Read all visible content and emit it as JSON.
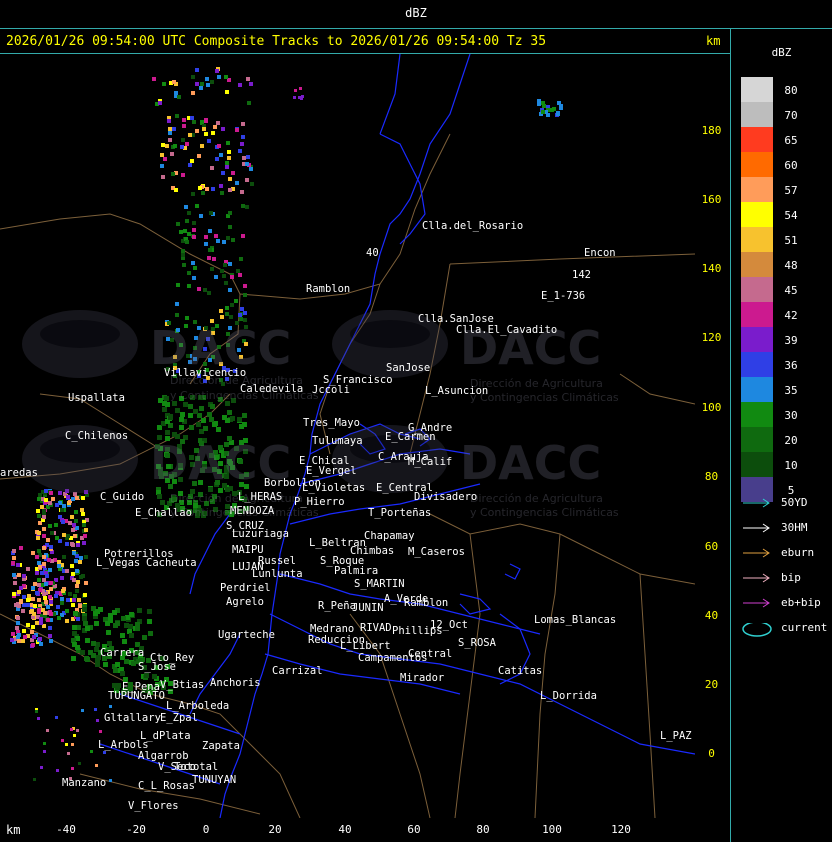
{
  "header": {
    "field": "dBZ",
    "title": "2026/01/26 09:54:00 UTC Composite Tracks to 2026/01/26 09:54:00 Tz 35",
    "units": "km"
  },
  "y_axis": {
    "ticks": [
      "180",
      "160",
      "140",
      "120",
      "100",
      "80",
      "60",
      "40",
      "20",
      "0"
    ]
  },
  "x_axis": {
    "unit": "km",
    "ticks": [
      "-40",
      "-20",
      "0",
      "20",
      "40",
      "60",
      "80",
      "100",
      "120"
    ]
  },
  "legend": {
    "title": "dBZ",
    "scale": [
      {
        "value": "80",
        "color": "#d6d6d6"
      },
      {
        "value": "70",
        "color": "#bdbdbd"
      },
      {
        "value": "65",
        "color": "#ff3b1f"
      },
      {
        "value": "60",
        "color": "#ff6a00"
      },
      {
        "value": "57",
        "color": "#ff9c5a"
      },
      {
        "value": "54",
        "color": "#ffff00"
      },
      {
        "value": "51",
        "color": "#f7c22e"
      },
      {
        "value": "48",
        "color": "#d48a3c"
      },
      {
        "value": "45",
        "color": "#c56a8e"
      },
      {
        "value": "42",
        "color": "#cc1a8f"
      },
      {
        "value": "39",
        "color": "#7a1ccc"
      },
      {
        "value": "36",
        "color": "#2f3fe6"
      },
      {
        "value": "35",
        "color": "#1e88e0"
      },
      {
        "value": "30",
        "color": "#118a11"
      },
      {
        "value": "20",
        "color": "#0f6a0f"
      },
      {
        "value": "10",
        "color": "#0c4d0c"
      },
      {
        "value": "5",
        "color": "#483e8c"
      }
    ],
    "tracks": [
      {
        "label": "50YD",
        "color": "#30d0d0"
      },
      {
        "label": "30HM",
        "color": "#ffffff"
      },
      {
        "label": "eburn",
        "color": "#e0a040"
      },
      {
        "label": "bip",
        "color": "#f0b0c0"
      },
      {
        "label": "eb+bip",
        "color": "#d040d0"
      },
      {
        "label": "current",
        "color": "#30d0d0"
      }
    ]
  },
  "watermark": {
    "name": "DACC",
    "line1": "Dirección de Agricultura",
    "line2": "y Contingencias Climáticas"
  },
  "places": [
    "Clla.del_Rosario",
    "Encon",
    "142",
    "E_1-736",
    "Ramblon",
    "40",
    "Clla.SanJose",
    "Clla.El_Cavadito",
    "Villavicencio",
    "S_Francisco",
    "SanJose",
    "Uspallata",
    "Caledevila",
    "Jccoli",
    "L_Asuncion",
    "Tres_Mayo",
    "G_Andre",
    "C_Chilenos",
    "Tulumaya",
    "E_Carmen",
    "E_Chical",
    "C_Arauja",
    "M_Calif",
    "aredas",
    "E_Vergel",
    "Borbollon",
    "L_Violetas",
    "E_Central",
    "Divisadero",
    "C_Guido",
    "L_HERAS",
    "P_Hierro",
    "T_Porteñas",
    "E_Challao",
    "MENDOZA",
    "S_CRUZ",
    "Luzuriaga",
    "Chapamay",
    "L_Beltran",
    "Potrerillos",
    "MAIPU",
    "Chimbas",
    "M_Caseros",
    "L_Vegas",
    "Cacheuta",
    "Russel",
    "S_Roque",
    "LUJAN",
    "Lunlunta",
    "Palmira",
    "S_MARTIN",
    "Perdriel",
    "A_Verde",
    "Agrelo",
    "R_Peña",
    "JUNIN",
    "Ramblon",
    "Lomas_Blancas",
    "Ugarteche",
    "Medrano",
    "RIVAD",
    "12_Oct",
    "Reduccion",
    "Phillips",
    "S_ROSA",
    "Carrera",
    "Cto_Rey",
    "L_Libert",
    "S_Jose",
    "Campamentos",
    "Central",
    "Carrizal",
    "Catitas",
    "Anchoris",
    "Mirador",
    "E_Pena",
    "V_Btias",
    "TUPUNGATO",
    "L_Dorrida",
    "L_Arboleda",
    "Gltallary",
    "E_Zpal",
    "L_dPlata",
    "L_Arbols",
    "Zapata",
    "Algarrob",
    "V_Seco",
    "Tototal",
    "TUNUYAN",
    "Manzano",
    "C_L_Rosas",
    "V_Flores",
    "L_PAZ"
  ]
}
